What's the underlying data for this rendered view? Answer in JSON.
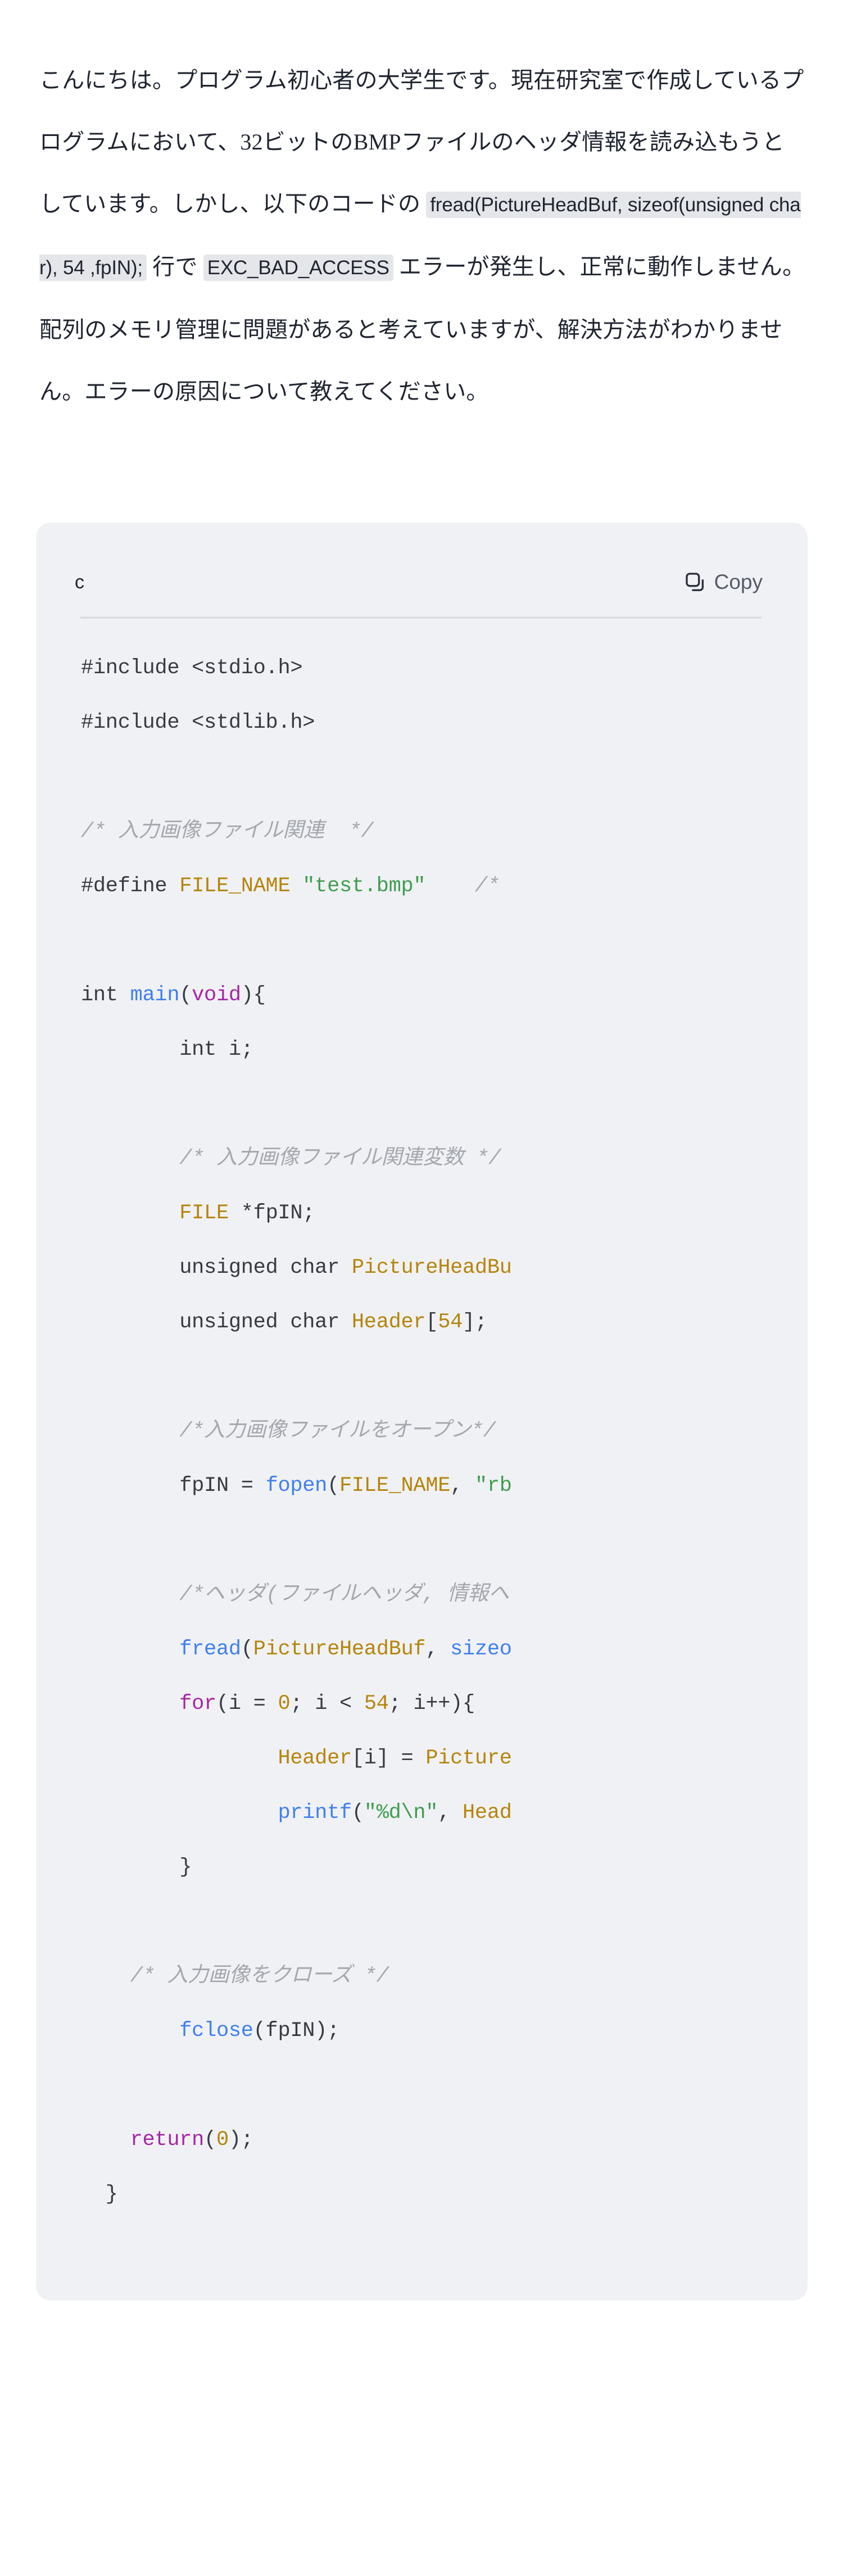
{
  "question": {
    "segments": [
      {
        "type": "text",
        "value": "こんにちは。プログラム初心者の大学生です。現在研究室で作成しているプログラムにおいて、32ビットのBMPファイルのヘッダ情報を読み込もうとしています。しかし、以下のコードの "
      },
      {
        "type": "code",
        "value": "fread(PictureHeadBuf, sizeof(unsigned char), 54 ,fpIN);"
      },
      {
        "type": "text",
        "value": " 行で "
      },
      {
        "type": "code",
        "value": "EXC_BAD_ACCESS"
      },
      {
        "type": "text",
        "value": " エラーが発生し、正常に動作しません。配列のメモリ管理に問題があると考えていますが、解決方法がわかりません。エラーの原因について教えてください。"
      }
    ]
  },
  "code_block": {
    "language_label": "c",
    "copy_label": "Copy",
    "copy_icon": "clipboard-icon",
    "lines": [
      [
        {
          "t": "pl",
          "v": "#include <stdio.h>"
        }
      ],
      [
        {
          "t": "pl",
          "v": "#include <stdlib.h>"
        }
      ],
      [
        {
          "t": "pl",
          "v": ""
        }
      ],
      [
        {
          "t": "com",
          "v": "/* 入力画像ファイル関連  */"
        }
      ],
      [
        {
          "t": "pl",
          "v": "#define "
        },
        {
          "t": "id",
          "v": "FILE_NAME"
        },
        {
          "t": "pl",
          "v": " "
        },
        {
          "t": "str",
          "v": "\"test.bmp\""
        },
        {
          "t": "pl",
          "v": "    "
        },
        {
          "t": "com",
          "v": "/*"
        }
      ],
      [
        {
          "t": "pl",
          "v": ""
        }
      ],
      [
        {
          "t": "pl",
          "v": "int "
        },
        {
          "t": "fn",
          "v": "main"
        },
        {
          "t": "pl",
          "v": "("
        },
        {
          "t": "kw",
          "v": "void"
        },
        {
          "t": "pl",
          "v": "){"
        }
      ],
      [
        {
          "t": "pl",
          "v": "        int i;"
        }
      ],
      [
        {
          "t": "pl",
          "v": ""
        }
      ],
      [
        {
          "t": "pl",
          "v": "        "
        },
        {
          "t": "com",
          "v": "/* 入力画像ファイル関連変数 */"
        }
      ],
      [
        {
          "t": "pl",
          "v": "        "
        },
        {
          "t": "id",
          "v": "FILE"
        },
        {
          "t": "pl",
          "v": " *fpIN;"
        }
      ],
      [
        {
          "t": "pl",
          "v": "        unsigned char "
        },
        {
          "t": "id",
          "v": "PictureHeadBu"
        }
      ],
      [
        {
          "t": "pl",
          "v": "        unsigned char "
        },
        {
          "t": "id",
          "v": "Header"
        },
        {
          "t": "pl",
          "v": "["
        },
        {
          "t": "num",
          "v": "54"
        },
        {
          "t": "pl",
          "v": "];"
        }
      ],
      [
        {
          "t": "pl",
          "v": ""
        }
      ],
      [
        {
          "t": "pl",
          "v": "        "
        },
        {
          "t": "com",
          "v": "/*入力画像ファイルをオープン*/"
        }
      ],
      [
        {
          "t": "pl",
          "v": "        fpIN = "
        },
        {
          "t": "fn",
          "v": "fopen"
        },
        {
          "t": "pl",
          "v": "("
        },
        {
          "t": "id",
          "v": "FILE_NAME"
        },
        {
          "t": "pl",
          "v": ", "
        },
        {
          "t": "str",
          "v": "\"rb"
        }
      ],
      [
        {
          "t": "pl",
          "v": ""
        }
      ],
      [
        {
          "t": "pl",
          "v": "        "
        },
        {
          "t": "com",
          "v": "/*ヘッダ(ファイルヘッダ, 情報ヘ"
        }
      ],
      [
        {
          "t": "pl",
          "v": "        "
        },
        {
          "t": "fn",
          "v": "fread"
        },
        {
          "t": "pl",
          "v": "("
        },
        {
          "t": "id",
          "v": "PictureHeadBuf"
        },
        {
          "t": "pl",
          "v": ", "
        },
        {
          "t": "fn",
          "v": "sizeo"
        }
      ],
      [
        {
          "t": "pl",
          "v": "        "
        },
        {
          "t": "kw",
          "v": "for"
        },
        {
          "t": "pl",
          "v": "(i = "
        },
        {
          "t": "num",
          "v": "0"
        },
        {
          "t": "pl",
          "v": "; i < "
        },
        {
          "t": "num",
          "v": "54"
        },
        {
          "t": "pl",
          "v": "; i++){"
        }
      ],
      [
        {
          "t": "pl",
          "v": "                "
        },
        {
          "t": "id",
          "v": "Header"
        },
        {
          "t": "pl",
          "v": "[i] = "
        },
        {
          "t": "id",
          "v": "Picture"
        }
      ],
      [
        {
          "t": "pl",
          "v": "                "
        },
        {
          "t": "fn",
          "v": "printf"
        },
        {
          "t": "pl",
          "v": "("
        },
        {
          "t": "str",
          "v": "\"%d\\n\""
        },
        {
          "t": "pl",
          "v": ", "
        },
        {
          "t": "id",
          "v": "Head"
        }
      ],
      [
        {
          "t": "pl",
          "v": "        }"
        }
      ],
      [
        {
          "t": "pl",
          "v": ""
        }
      ],
      [
        {
          "t": "pl",
          "v": "    "
        },
        {
          "t": "com",
          "v": "/* 入力画像をクローズ */"
        }
      ],
      [
        {
          "t": "pl",
          "v": "        "
        },
        {
          "t": "fn",
          "v": "fclose"
        },
        {
          "t": "pl",
          "v": "(fpIN);"
        }
      ],
      [
        {
          "t": "pl",
          "v": ""
        }
      ],
      [
        {
          "t": "pl",
          "v": "    "
        },
        {
          "t": "kw",
          "v": "return"
        },
        {
          "t": "pl",
          "v": "("
        },
        {
          "t": "num",
          "v": "0"
        },
        {
          "t": "pl",
          "v": ");"
        }
      ],
      [
        {
          "t": "pl",
          "v": "  }"
        }
      ]
    ]
  },
  "colors": {
    "page_background": "#ffffff",
    "body_text": "#1f2430",
    "inline_code_background": "#e4e6e9",
    "code_card_background": "#f0f1f4",
    "code_divider": "#dcdee3",
    "comment": "#a4a8ae",
    "keyword": "#a626a4",
    "function": "#3f7ff0",
    "identifier": "#b5840a",
    "string": "#3f9d4f",
    "number": "#b5840a",
    "plain": "#383a42",
    "copy_label": "#555b68"
  }
}
